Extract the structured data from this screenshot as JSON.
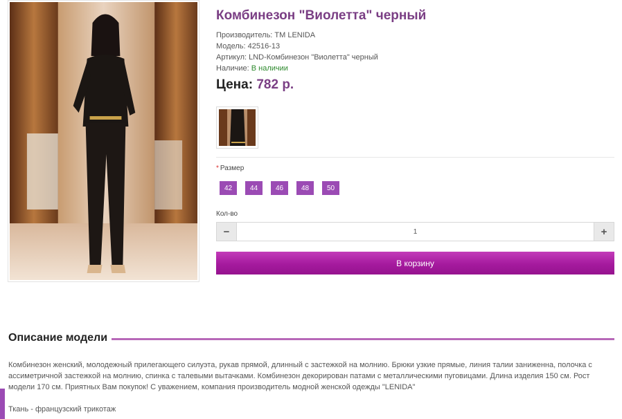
{
  "product": {
    "title": "Комбинезон \"Виолетта\" черный",
    "manufacturer": "Производитель: ТМ LENIDA",
    "model": "Модель: 42516-13",
    "article": "Артикул: LND-Комбинезон \"Виолетта\" черный",
    "availability_label": "Наличие: ",
    "availability_value": "В наличии",
    "price_label": "Цена:",
    "price_value": "782 р."
  },
  "options": {
    "size_required_mark": "*",
    "size_label": "Размер",
    "sizes": [
      "42",
      "44",
      "46",
      "48",
      "50"
    ],
    "quantity_label": "Кол-во",
    "quantity_value": "1",
    "minus": "−",
    "plus": "+"
  },
  "cart": {
    "button_label": "В корзину"
  },
  "description": {
    "title": "Описание модели",
    "text": "Комбинезон женский, молодежный прилегающего силуэта, рукав прямой, длинный с застежкой на молнию. Брюки узкие прямые, линия талии заниженна, полочка с ассиметричной застежкой на молнию, спинка с талевыми вытачками. Комбинезон декорирован патами с металлическими пуговицами. Длина изделия 150 см. Рост модели 170 см. Приятных Вам покупок! С уважением, компания производитель модной женской одежды \"LENIDA\"",
    "fabric": "Ткань - французский трикотаж"
  },
  "colors": {
    "accent": "#7a3e84",
    "button": "#9b4bb4",
    "cart": "#a51a9e",
    "in_stock": "#2e8a2e"
  }
}
